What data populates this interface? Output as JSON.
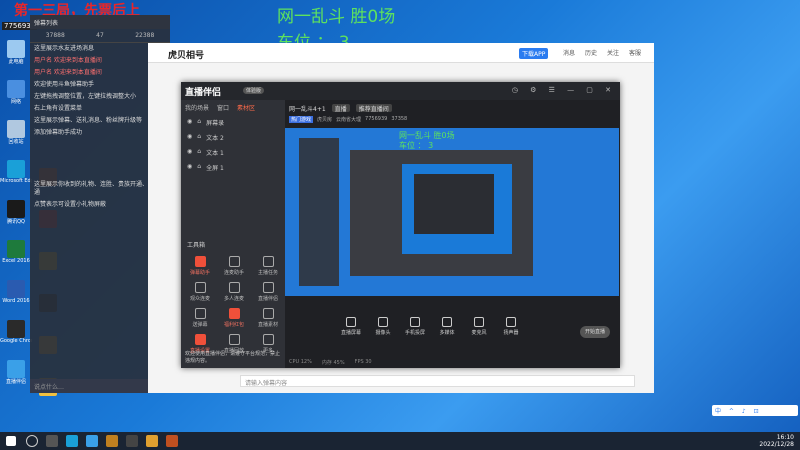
{
  "overlay": {
    "line1": "第一三局，先票后上",
    "id": "7756939",
    "big_line1": "网一乱斗 胜0场",
    "big_line2": "车位 ： 3"
  },
  "desktop_icons": [
    {
      "label": "此电脑",
      "color": "#9cc9f0"
    },
    {
      "label": "网络",
      "color": "#4a8fe0"
    },
    {
      "label": "回收站",
      "color": "#b0c8e0"
    },
    {
      "label": "Microsoft Edge",
      "color": "#1aa0d8"
    },
    {
      "label": "腾讯QQ",
      "color": "#1a1a1a"
    },
    {
      "label": "Excel 2016",
      "color": "#1e7a3c"
    },
    {
      "label": "Word 2016",
      "color": "#2a5bb0"
    },
    {
      "label": "Google Chrome",
      "color": "#2a2a2a"
    },
    {
      "label": "直播伴侣",
      "color": "#3aa0e8"
    }
  ],
  "desktop_icons_col2": [
    {
      "label": "",
      "color": "#c05020"
    },
    {
      "label": "",
      "color": "#d03030"
    },
    {
      "label": "",
      "color": "#e0b020"
    },
    {
      "label": "",
      "color": "#202020"
    },
    {
      "label": "",
      "color": "#e0a030"
    },
    {
      "label": "",
      "color": "#f0c040"
    }
  ],
  "chat": {
    "header": "弹幕列表",
    "stats": [
      "37888",
      "47",
      "22388"
    ],
    "messages": [
      "这里展示水友进场消息",
      "用户名 欢迎来到本直播间",
      "用户名 欢迎来到本直播间",
      "欢迎使用斗鱼弹幕助手",
      "左键拖拽调整位置，左键拉拽调整大小",
      "右上角有设置菜单",
      "这里展示弹幕、送礼消息、粉丝牌升级等",
      "添加弹幕助手成功",
      "这里展示你收到的礼物、连胜、贵族开通、钻粉开通",
      "点赞表示可设置小礼物屏蔽"
    ],
    "footer": "说点什么…"
  },
  "bg_window": {
    "logo": "虎贝相号",
    "app_label": "下载APP",
    "actions": [
      "消息",
      "历史",
      "关注",
      "客服"
    ],
    "input_placeholder": "请输入弹幕内容"
  },
  "main_window": {
    "title": "直播伴侣",
    "badge": "体验版",
    "left_tabs": [
      "我的场景",
      "窗口",
      "素材区"
    ],
    "scenes": [
      "屏幕录",
      "文本 2",
      "文本 1",
      "全屏 1"
    ],
    "tools_title": "工具箱",
    "tools": [
      "弹幕助手",
      "连麦助手",
      "主播任务",
      "观众连麦",
      "多人连麦",
      "直播伴侣",
      "送弹幕",
      "福利红包",
      "直播素材",
      "直播设置",
      "直播回放",
      "更多"
    ],
    "right_top": [
      "网一乱斗4+1",
      "直播",
      "推荐直播间"
    ],
    "info": [
      "热门游戏",
      "虎贝房",
      "云南省大理",
      "7756939",
      "37358"
    ],
    "preview_line1": "网一乱斗 胜0场",
    "preview_line2": "车位 ： 3",
    "bottom_tools": [
      "直播屏幕",
      "摄像头",
      "手机投屏",
      "多媒体",
      "麦克风",
      "扬声器"
    ],
    "start_label": "开始直播",
    "status": [
      "CPU 12%",
      "内存 45%",
      "FPS 30"
    ],
    "notice": "欢迎使用直播伴侣，请遵守平台规范，禁止违规内容。"
  },
  "taskbar": {
    "tray": "中 ^ ♪ ⊡",
    "time": "16:10",
    "date": "2022/12/28"
  }
}
